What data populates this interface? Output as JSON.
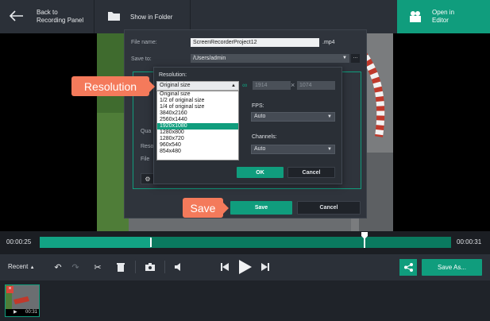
{
  "topbar": {
    "back_label_1": "Back to",
    "back_label_2": "Recording Panel",
    "show_folder_label": "Show in Folder",
    "editor_label_1": "Open in",
    "editor_label_2": "Editor"
  },
  "dialog": {
    "file_name_label": "File name:",
    "file_name_value": "ScreenRecorderProject12",
    "extension": ".mp4",
    "save_to_label": "Save to:",
    "save_to_value": "/Users/admin",
    "browse_label": "...",
    "partial_labels": [
      "Qua",
      "Reso",
      "File"
    ],
    "save_button": "Save",
    "cancel_button": "Cancel"
  },
  "resolution_panel": {
    "resolution_label": "Resolution:",
    "selected_value": "Original size",
    "width_value": "1914",
    "height_value": "1074",
    "times_sign": "×",
    "fps_label": "FPS:",
    "fps_value": "Auto",
    "channels_label": "Channels:",
    "channels_value": "Auto",
    "ok_button": "OK",
    "cancel_button": "Cancel",
    "options": [
      "Original size",
      "1/2 of original size",
      "1/4 of original size",
      "3840x2160",
      "2560x1440",
      "1920x1080",
      "1280x800",
      "1280x720",
      "960x540",
      "854x480"
    ],
    "highlighted_option": "1920x1080"
  },
  "callouts": {
    "resolution": "Resolution",
    "save": "Save"
  },
  "timeline": {
    "current_time": "00:00:25",
    "total_time": "00:00:31",
    "played_fraction": 0.27,
    "marker_fraction": 0.79
  },
  "toolbar": {
    "recent_label": "Recent",
    "save_as_label": "Save As..."
  },
  "recent": {
    "thumb_time": "00:31"
  },
  "colors": {
    "accent": "#109d7d",
    "callout": "#f47a5b"
  }
}
